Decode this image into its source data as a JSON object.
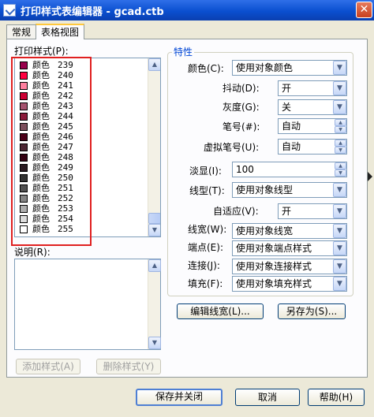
{
  "window": {
    "title": "打印样式表编辑器 - gcad.ctb",
    "close_glyph": "✕"
  },
  "tabs": [
    {
      "label": "常规",
      "active": false
    },
    {
      "label": "表格视图",
      "active": true
    }
  ],
  "print_styles": {
    "label": "打印样式(P):",
    "items": [
      {
        "name": "颜色",
        "num": "239",
        "color": "#99004c"
      },
      {
        "name": "颜色",
        "num": "240",
        "color": "#ff0040"
      },
      {
        "name": "颜色",
        "num": "241",
        "color": "#ff7f9f"
      },
      {
        "name": "颜色",
        "num": "242",
        "color": "#cc0033"
      },
      {
        "name": "颜色",
        "num": "243",
        "color": "#a5526e"
      },
      {
        "name": "颜色",
        "num": "244",
        "color": "#8b1a3a"
      },
      {
        "name": "颜色",
        "num": "245",
        "color": "#7c4e5c"
      },
      {
        "name": "颜色",
        "num": "246",
        "color": "#4c0019"
      },
      {
        "name": "颜色",
        "num": "247",
        "color": "#4c2633"
      },
      {
        "name": "颜色",
        "num": "248",
        "color": "#330011"
      },
      {
        "name": "颜色",
        "num": "249",
        "color": "#2a1a20"
      },
      {
        "name": "颜色",
        "num": "250",
        "color": "#333333"
      },
      {
        "name": "颜色",
        "num": "251",
        "color": "#505050"
      },
      {
        "name": "颜色",
        "num": "252",
        "color": "#848484"
      },
      {
        "name": "颜色",
        "num": "253",
        "color": "#aeaeae"
      },
      {
        "name": "颜色",
        "num": "254",
        "color": "#dcdcdc"
      },
      {
        "name": "颜色",
        "num": "255",
        "color": "#ffffff"
      }
    ]
  },
  "description": {
    "label": "说明(R):",
    "value": ""
  },
  "left_buttons": {
    "add_style": "添加样式(A)",
    "delete_style": "删除样式(Y)"
  },
  "properties": {
    "title": "特性",
    "color": {
      "label": "颜色(C):",
      "value": "使用对象颜色"
    },
    "dither": {
      "label": "抖动(D):",
      "value": "开"
    },
    "grayscale": {
      "label": "灰度(G):",
      "value": "关"
    },
    "pen": {
      "label": "笔号(#):",
      "value": "自动"
    },
    "virtual_pen": {
      "label": "虚拟笔号(U):",
      "value": "自动"
    },
    "screening": {
      "label": "淡显(I):",
      "value": "100"
    },
    "linetype": {
      "label": "线型(T):",
      "value": "使用对象线型"
    },
    "adaptive": {
      "label": "自适应(V):",
      "value": "开"
    },
    "lineweight": {
      "label": "线宽(W):",
      "value": "使用对象线宽"
    },
    "line_end": {
      "label": "端点(E):",
      "value": "使用对象端点样式"
    },
    "line_join": {
      "label": "连接(J):",
      "value": "使用对象连接样式"
    },
    "fill": {
      "label": "填充(F):",
      "value": "使用对象填充样式"
    },
    "edit_lineweights": "编辑线宽(L)...",
    "save_as": "另存为(S)..."
  },
  "footer": {
    "save_close": "保存并关闭",
    "cancel": "取消",
    "help": "帮助(H)"
  }
}
